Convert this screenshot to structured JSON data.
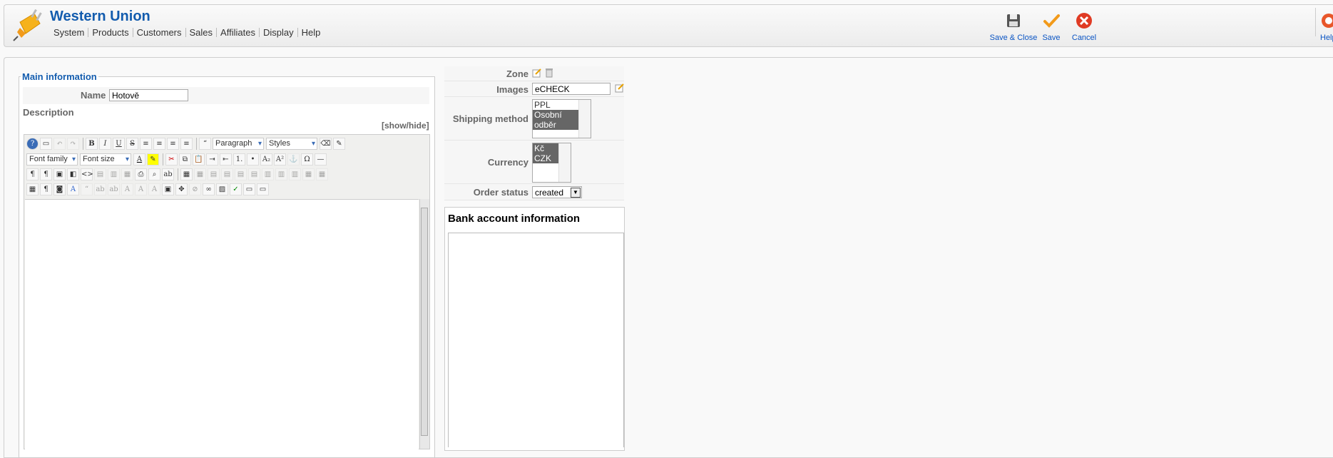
{
  "header": {
    "title": "Western Union",
    "menu": [
      "System",
      "Products",
      "Customers",
      "Sales",
      "Affiliates",
      "Display",
      "Help"
    ],
    "toolbar": {
      "save_close": "Save & Close",
      "save": "Save",
      "cancel": "Cancel",
      "help": "Help"
    }
  },
  "main": {
    "legend": "Main information",
    "name_label": "Name",
    "name_value": "Hotově",
    "description_label": "Description",
    "show_hide": "[show/hide]",
    "editor": {
      "format_select": "Paragraph",
      "styles_select": "Styles",
      "font_family": "Font family",
      "font_size": "Font size"
    }
  },
  "side": {
    "zone_label": "Zone",
    "images_label": "Images",
    "images_value": "eCHECK",
    "shipping_label": "Shipping method",
    "shipping_options": [
      "PPL",
      "Osobní odběr"
    ],
    "currency_label": "Currency",
    "currency_options": [
      "Kč CZK"
    ],
    "order_status_label": "Order status",
    "order_status_value": "created",
    "bank_title": "Bank account information"
  },
  "colors": {
    "accent": "#135cae",
    "link": "#0b55c4",
    "cancel_red": "#e03b24",
    "save_orange": "#f29a1a"
  }
}
